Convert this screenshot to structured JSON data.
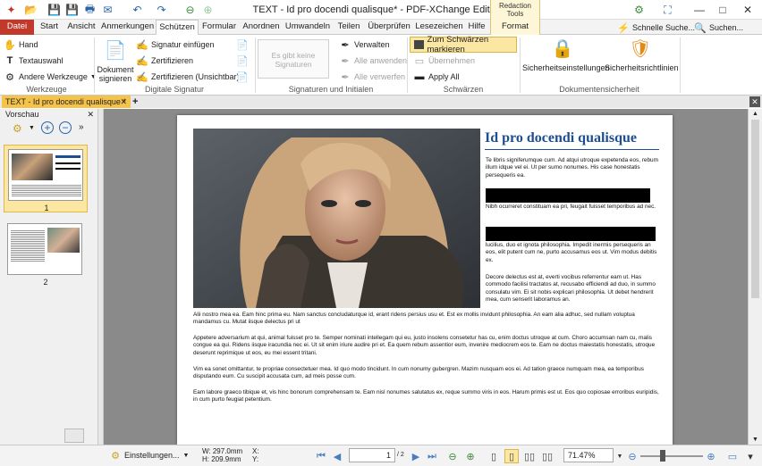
{
  "window": {
    "title": "TEXT - Id pro docendi qualisque* - PDF-XChange Editor",
    "context_group": "Redaction Tools",
    "minimize": "—",
    "maximize": "□",
    "close": "✕"
  },
  "tabs": [
    "Datei",
    "Start",
    "Ansicht",
    "Anmerkungen",
    "Schützen",
    "Formular",
    "Anordnen",
    "Umwandeln",
    "Teilen",
    "Überprüfen",
    "Lesezeichen",
    "Hilfe",
    "Format"
  ],
  "active_tab": "Schützen",
  "header_right": {
    "quick_launch": "Schnelle Suche...",
    "search": "Suchen..."
  },
  "ribbon": {
    "tools": {
      "hand": "Hand",
      "text_select": "Textauswahl",
      "other_tools": "Andere Werkzeuge",
      "label": "Werkzeuge"
    },
    "digital_signature": {
      "sign_doc_line1": "Dokument",
      "sign_doc_line2": "signieren",
      "insert_sig": "Signatur einfügen",
      "certify": "Zertifizieren",
      "certify_invisible": "Zertifizieren (Unsichtbar)",
      "label": "Digitale Signatur"
    },
    "signatures": {
      "empty_line1": "Es gibt keine",
      "empty_line2": "Signaturen",
      "manage": "Verwalten",
      "apply_all": "Alle anwenden",
      "discard_all": "Alle verwerfen",
      "label": "Signaturen und Initialen"
    },
    "redaction": {
      "mark": "Zum Schwärzen markieren",
      "accept": "Übernehmen",
      "apply_all": "Apply All",
      "label": "Schwärzen"
    },
    "security": {
      "settings": "Sicherheitseinstellungen",
      "policies": "Sicherheitsrichtlinien",
      "label": "Dokumentensicherheit"
    }
  },
  "doc_tab": {
    "title": "TEXT - Id pro docendi qualisque *"
  },
  "left_panel": {
    "title": "Vorschau",
    "pages": [
      "1",
      "2"
    ]
  },
  "document": {
    "heading": "Id pro docendi qualisque",
    "p1": "Te libris signiferumque cum. Ad atqui utroque expetenda eos, rebum illum idque vel ei. Ut per sumo nonumes. His case honestatis persequeris ea.",
    "p2": "Nibh ocurreret constituam ea pri, feugait fuisset temporibus ad nec.",
    "p3": "lucilius, duo et ignota philosophia. Impedit inermis persequeris an eos, elit putent cum ne, purto accusamus eos ut. Vim modus debitis ex.",
    "p4": "Decore delectus est at, everti vocibus referrentur eam ut. Has commodo facilisi tractatos at, recusabo efficiendi ad duo, in summo consulatu vim. Ei sit nobis explicari philosophia. Ut debet hendrerit mea, cum senserit laboramus an.",
    "p5": "Alii nostro mea ea. Eam hinc prima eu. Nam sanctus concludaturque id, erant ridens persius usu et. Est ex mollis invidunt philosophia. An eam alia adhuc, sed nullam voluptua mandamus cu. Mutat iisque delectus pri ut",
    "p6": "Appetere adversarium at qui, animal fuisset pro te. Semper nominati intellegam qui eu, justo insolens consetetur has cu, enim doctus utroque at cum. Choro accumsan nam cu, malis congue ea qui. Ridens iisque iracundia nec ei. Ut sit enim iriure audire pri et. Ea quem rebum assentior eum, invenire mediocrem eos te. Eam ne doctus maiestatis honestatis, utroque deserunt reprimique ut eos, eu mei essent tritani.",
    "p7": "Vim ea sonet omittantur, te propriae consectetuer mea. Id quo modo tincidunt. In cum nonumy gubergren. Mazim nusquam eos ei. Ad tation graece numquam mea, ea temporibus disputando eum. Cu suscipit accusata cum, ad meis posse cum.",
    "p8": "Eam labore graeco tibique et, vis hinc bonorum comprehensam te. Eam nisl nonumes salutatus ex, reque summo viris in eos. Harum primis est ut. Eos quo copiosae erroribus euripidis, in cum purto feugiat petentium."
  },
  "status": {
    "settings": "Einstellungen...",
    "width": "W: 297.0mm",
    "height": "H: 209.9mm",
    "x": "X:",
    "y": "Y:",
    "page": "1",
    "page_total": "/ 2",
    "zoom": "71.47%"
  }
}
